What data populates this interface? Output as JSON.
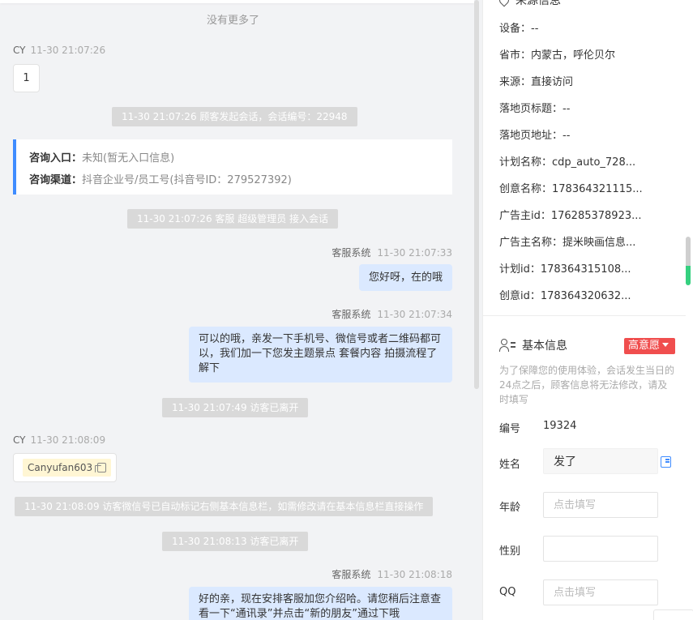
{
  "chat": {
    "no_more": "没有更多了",
    "msg1": {
      "sender": "CY",
      "time": "11-30 21:07:26",
      "text": "1"
    },
    "sys1": "11-30 21:07:26 顾客发起会话，会话编号：22948",
    "card": {
      "entry_label": "咨询入口：",
      "entry_value": "未知(暂无入口信息)",
      "channel_label": "咨询渠道：",
      "channel_value": "抖音企业号/员工号(抖音号ID：279527392)"
    },
    "sys2": "11-30 21:07:26 客服 超级管理员 接入会话",
    "msg2": {
      "sender": "客服系统",
      "time": "11-30 21:07:33",
      "text": "您好呀，在的哦"
    },
    "msg3": {
      "sender": "客服系统",
      "time": "11-30 21:07:34",
      "text": "可以的哦，亲发一下手机号、微信号或者二维码都可以，我们加一下您发主题景点 套餐内容 拍摄流程了解下"
    },
    "sys3": "11-30 21:07:49 访客已离开",
    "msg4": {
      "sender": "CY",
      "time": "11-30 21:08:09",
      "text": "Canyufan603"
    },
    "sys4": "11-30 21:08:09 访客微信号已自动标记右侧基本信息栏，如需修改请在基本信息栏直接操作",
    "sys5": "11-30 21:08:13 访客已离开",
    "msg5": {
      "sender": "客服系统",
      "time": "11-30 21:08:18",
      "text": "好的亲，现在安排客服加您介绍哈。请您稍后注意查看一下“通讯录”并点击“新的朋友”通过下哦"
    }
  },
  "source": {
    "title": "来源信息",
    "rows": [
      "设备：--",
      "省市：内蒙古，呼伦贝尔",
      "来源：直接访问",
      "落地页标题：--",
      "落地页地址：--",
      "计划名称：cdp_auto_728...",
      "创意名称：178364321115...",
      "广告主id：176285378923...",
      "广告主名称：提米映画信息...",
      "计划id：178364315108...",
      "创意id：178364320632..."
    ]
  },
  "basic": {
    "title": "基本信息",
    "intent": "高意愿",
    "notice": "为了保障您的使用体验，会话发生当日的24点之后，顾客信息将无法修改，请及时填写",
    "id_label": "编号",
    "id_value": "19324",
    "name_label": "姓名",
    "name_value": "发了",
    "age_label": "年龄",
    "age_placeholder": "点击填写",
    "gender_label": "性别",
    "qq_label": "QQ",
    "qq_placeholder": "点击填写"
  }
}
